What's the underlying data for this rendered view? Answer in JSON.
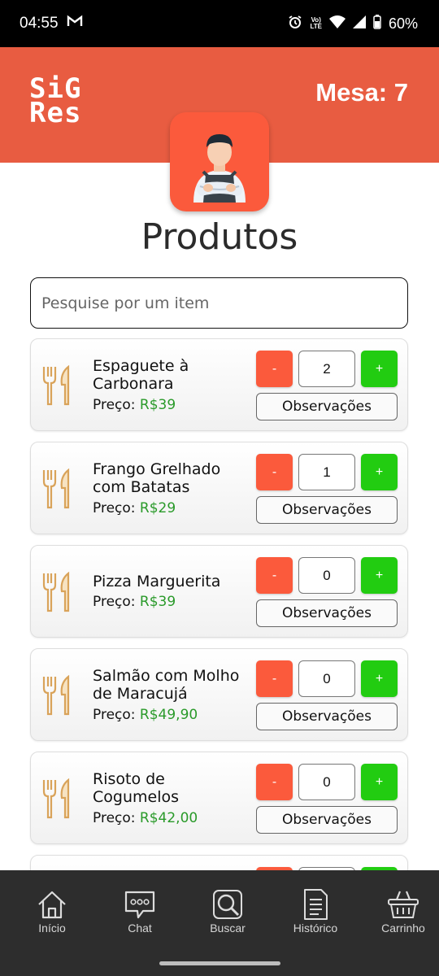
{
  "status_bar": {
    "time": "04:55",
    "battery": "60%",
    "network": "LTE"
  },
  "header": {
    "logo_line1": "SiG",
    "logo_line2": "Res",
    "mesa": "Mesa: 7"
  },
  "page": {
    "title": "Produtos"
  },
  "search": {
    "placeholder": "Pesquise por um item",
    "value": ""
  },
  "products": [
    {
      "name": "Espaguete à Carbonara",
      "price_label": "Preço:",
      "price": "R$39",
      "quantity": "2",
      "obs_label": "Observações"
    },
    {
      "name": "Frango Grelhado com Batatas",
      "price_label": "Preço:",
      "price": "R$29",
      "quantity": "1",
      "obs_label": "Observações"
    },
    {
      "name": "Pizza Marguerita",
      "price_label": "Preço:",
      "price": "R$39",
      "quantity": "0",
      "obs_label": "Observações"
    },
    {
      "name": "Salmão com Molho de Maracujá",
      "price_label": "Preço:",
      "price": "R$49,90",
      "quantity": "0",
      "obs_label": "Observações"
    },
    {
      "name": "Risoto de Cogumelos",
      "price_label": "Preço:",
      "price": "R$42,00",
      "quantity": "0",
      "obs_label": "Observações"
    }
  ],
  "qty_buttons": {
    "minus": "-",
    "plus": "+"
  },
  "nav": [
    {
      "label": "Início",
      "icon": "home-icon"
    },
    {
      "label": "Chat",
      "icon": "chat-icon"
    },
    {
      "label": "Buscar",
      "icon": "search-icon"
    },
    {
      "label": "Histórico",
      "icon": "document-icon"
    },
    {
      "label": "Carrinho",
      "icon": "basket-icon"
    }
  ],
  "colors": {
    "header": "#e85c41",
    "minus": "#fb5a3c",
    "plus": "#22cc11",
    "price": "#2a9a2a",
    "nav": "#2d2d2d"
  }
}
